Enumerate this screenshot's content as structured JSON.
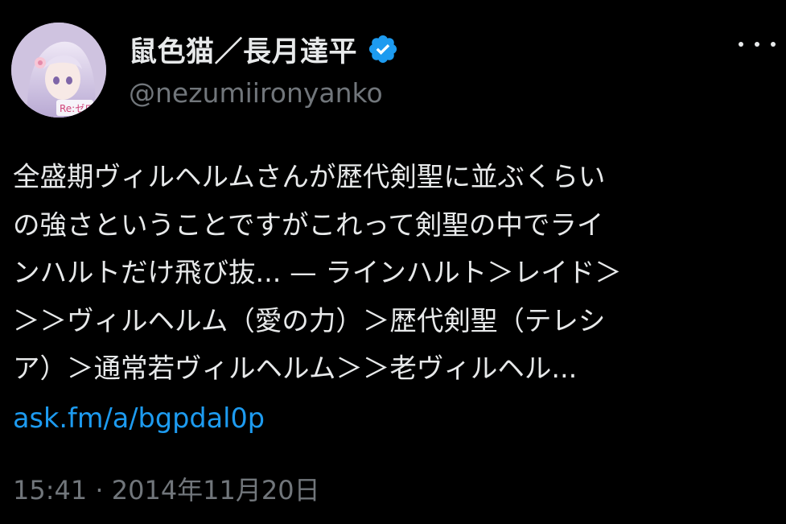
{
  "tweet": {
    "author": {
      "display_name": "鼠色猫／長月達平",
      "handle": "@nezumiironyanko",
      "avatar_icon": "avatar-icon",
      "verified_icon": "verified-badge-icon"
    },
    "more_icon": "more-options-icon",
    "body_lines": [
      "全盛期ヴィルヘルムさんが歴代剣聖に並ぶくらい",
      "の強さということですがこれって剣聖の中でライ",
      "ンハルトだけ飛び抜... — ラインハルト＞レイド＞",
      "＞＞ヴィルヘルム（愛の力）＞歴代剣聖（テレシ",
      "ア）＞通常若ヴィルヘルム＞＞老ヴィルヘル..."
    ],
    "link": "ask.fm/a/bgpdal0p",
    "timestamp": "15:41 · 2014年11月20日"
  },
  "colors": {
    "background": "#000000",
    "primary_text": "#e7e9ea",
    "secondary_text": "#71767b",
    "link": "#1d9bf0",
    "verified": "#1d9bf0"
  }
}
